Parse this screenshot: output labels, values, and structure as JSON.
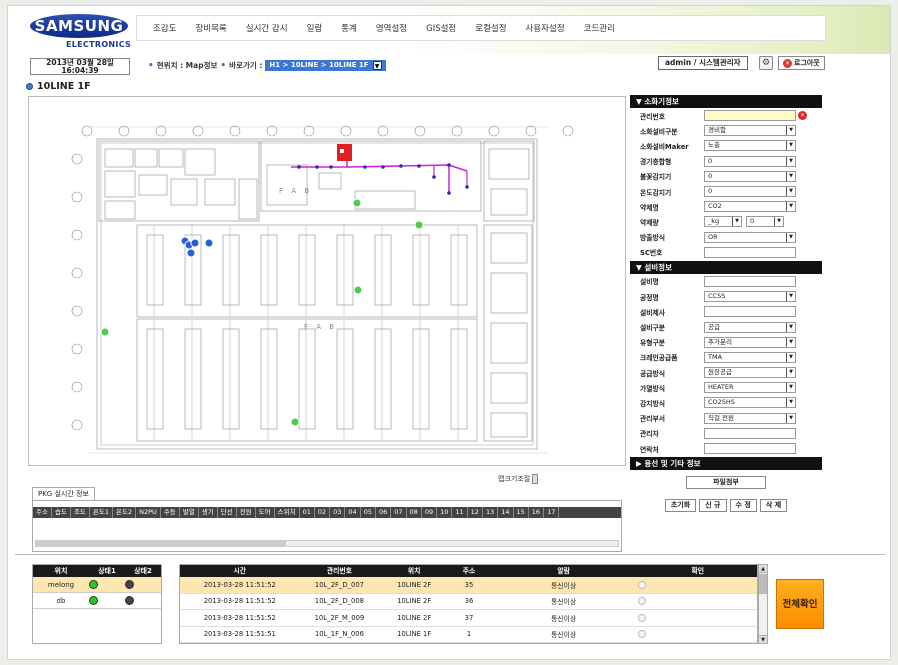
{
  "header": {
    "logo": "SAMSUNG",
    "logo_sub": "ELECTRONICS",
    "nav": [
      "조감도",
      "장비목록",
      "실시간 감시",
      "일람",
      "통계",
      "영역설정",
      "GIS설정",
      "로컬설정",
      "사용자설정",
      "코드관리"
    ]
  },
  "status": {
    "date": "2013년 03월 28일",
    "time": "16:04:39",
    "crumb_label_1": "현위치 : Map정보",
    "crumb_label_2": "바로가기 :",
    "location_select": "H1 > 10LINE > 10LINE 1F",
    "user": "admin / 시스템관리자",
    "logout": "로그아웃"
  },
  "page_title": "10LINE 1F",
  "map": {
    "fab_label": "F A B",
    "zoom_label": "맵크기조절"
  },
  "pkg": {
    "tab": "PKG 실시간 정보",
    "columns": [
      "주소",
      "습도",
      "조도",
      "온도1",
      "온도2",
      "N2PU",
      "수동",
      "발열",
      "생기",
      "단선",
      "전원",
      "도어",
      "스위치",
      "01",
      "02",
      "03",
      "04",
      "05",
      "06",
      "07",
      "08",
      "09",
      "10",
      "11",
      "12",
      "13",
      "14",
      "15",
      "16",
      "17"
    ]
  },
  "sensor_info": {
    "title": "▼ 소화기정보",
    "fields": [
      {
        "label": "관리번호",
        "value": "",
        "highlight": true,
        "clear": true
      },
      {
        "label": "소화설비구분",
        "value": "경비함",
        "select": true
      },
      {
        "label": "소화설비Maker",
        "value": "노출",
        "select": true
      },
      {
        "label": "경기충합형",
        "value": "0",
        "select": true
      },
      {
        "label": "불꽃감지기",
        "value": "0",
        "select": true
      },
      {
        "label": "온도감지기",
        "value": "0",
        "select": true
      },
      {
        "label": "약제명",
        "value": "CO2",
        "select": true
      },
      {
        "label": "약제량",
        "value": "_kg",
        "value2": "0",
        "select": true,
        "split": true
      },
      {
        "label": "방출방식",
        "value": "OR",
        "select": true
      },
      {
        "label": "SC번호",
        "value": ""
      }
    ]
  },
  "equip_info": {
    "title": "▼ 설비정보",
    "fields": [
      {
        "label": "설비명",
        "value": ""
      },
      {
        "label": "공정명",
        "value": "CCSS",
        "select": true
      },
      {
        "label": "설비제사",
        "value": ""
      },
      {
        "label": "설비구분",
        "value": "공급",
        "select": true
      },
      {
        "label": "유형구분",
        "value": "추가분리",
        "select": true
      },
      {
        "label": "크레인공급품",
        "value": "TMA",
        "select": true
      },
      {
        "label": "공급방식",
        "value": "원장공급",
        "select": true
      },
      {
        "label": "가열방식",
        "value": "HEATER",
        "select": true
      },
      {
        "label": "감지방식",
        "value": "CO2SHS",
        "select": true
      },
      {
        "label": "관리부서",
        "value": "직걸 전원",
        "select": true
      },
      {
        "label": "관리자",
        "value": ""
      },
      {
        "label": "연락처",
        "value": ""
      }
    ]
  },
  "other_info": {
    "title": "▶ 용선 및 기타 정보",
    "file_button": "파일첨부",
    "buttons": [
      "초기화",
      "신 규",
      "수 정",
      "삭 제"
    ]
  },
  "location_table": {
    "headers": [
      "위치",
      "상태1",
      "상태2"
    ],
    "rows": [
      {
        "name": "melong",
        "s1": "#22cc22",
        "s2": "#444444",
        "selected": true
      },
      {
        "name": "db",
        "s1": "#22cc22",
        "s2": "#444444",
        "selected": false
      }
    ]
  },
  "event_table": {
    "headers": [
      "시간",
      "관리번호",
      "위치",
      "주소",
      "알람",
      "확인"
    ],
    "rows": [
      {
        "time": "2013-03-28 11:51:52",
        "id": "10L_2F_D_007",
        "loc": "10LINE 2F",
        "addr": "35",
        "alarm": "통신이상"
      },
      {
        "time": "2013-03-28 11:51:52",
        "id": "10L_2F_D_008",
        "loc": "10LINE 2F",
        "addr": "36",
        "alarm": "통신이상"
      },
      {
        "time": "2013-03-28 11:51:52",
        "id": "10L_2F_M_009",
        "loc": "10LINE 2F",
        "addr": "37",
        "alarm": "통신이상"
      },
      {
        "time": "2013-03-28 11:51:51",
        "id": "10L_1F_N_006",
        "loc": "10LINE 1F",
        "addr": "1",
        "alarm": "통신이상"
      }
    ]
  },
  "confirm_all": "전체확인",
  "colors": {
    "accent": "#3a78d8",
    "header_dark": "#111111",
    "alarm_orange": "#ff9a10",
    "sensor_green": "#4fc94f",
    "sensor_blue": "#2a5fd8",
    "pipe_magenta": "#d020d0",
    "red_marker": "#e02020"
  }
}
